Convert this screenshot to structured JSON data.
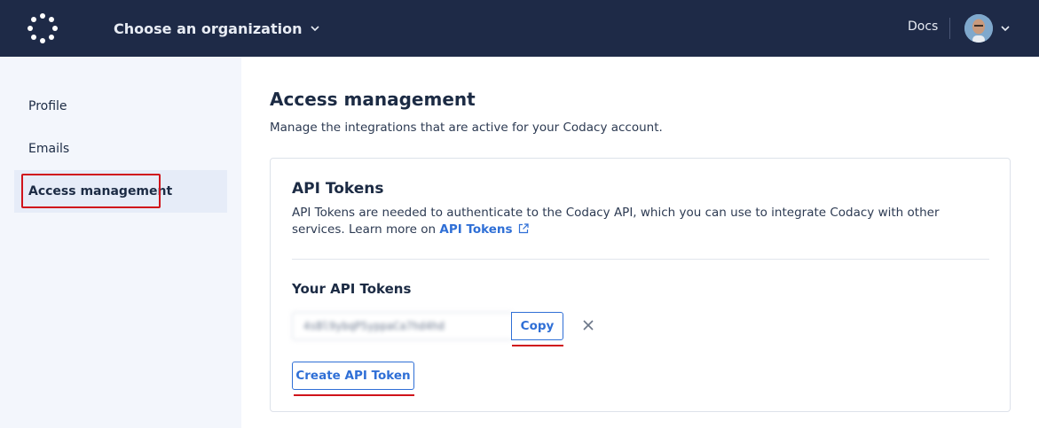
{
  "header": {
    "logo_icon": "codacy-logo-icon",
    "org_selector": "Choose an organization",
    "org_chevron_icon": "chevron-down-icon",
    "docs_link": "Docs",
    "avatar_icon": "user-avatar",
    "avatar_chevron_icon": "chevron-down-icon"
  },
  "sidebar": {
    "items": [
      {
        "label": "Profile",
        "active": false
      },
      {
        "label": "Emails",
        "active": false
      },
      {
        "label": "Access management",
        "active": true
      }
    ]
  },
  "main": {
    "title": "Access management",
    "subtitle": "Manage the integrations that are active for your Codacy account."
  },
  "api_tokens": {
    "title": "API Tokens",
    "description_prefix": "API Tokens are needed to authenticate to the Codacy API, which you can use to integrate Codacy with other services. Learn more on ",
    "link_label": "API Tokens",
    "link_icon": "external-link-icon",
    "your_tokens_title": "Your API Tokens",
    "token_value": "4sBl9ybqP5yppaCa7hd4hd",
    "copy_label": "Copy",
    "delete_icon": "close-icon",
    "create_label": "Create API Token"
  },
  "colors": {
    "topbar": "#1e2a47",
    "sidebar_bg": "#f3f6fc",
    "active_item_bg": "#e6ecf8",
    "accent": "#2f6fd6",
    "annotation_red": "#d0131b"
  }
}
